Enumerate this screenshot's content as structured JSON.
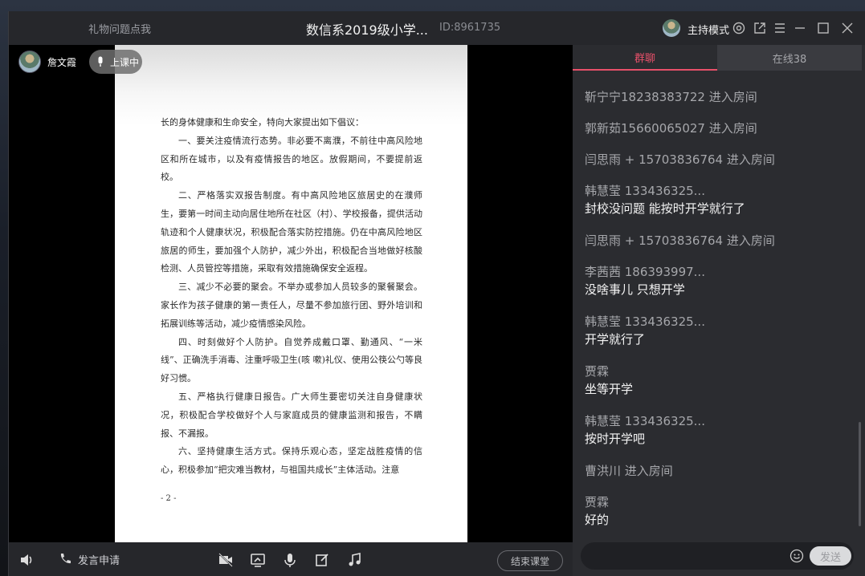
{
  "title_bar": {
    "gift_link": "礼物问题点我",
    "room_title": "数信系2019级小学...",
    "room_id": "ID:8961735",
    "host_mode": "主持模式",
    "icons": [
      "settings-icon",
      "share-icon",
      "menu-icon",
      "minimize-icon",
      "maximize-icon",
      "close-icon"
    ]
  },
  "stage": {
    "teacher_name": "詹文霞",
    "class_status": "上课中",
    "document": {
      "paragraphs": [
        "长的身体健康和生命安全，特向大家提出如下倡议：",
        "一、要关注疫情流行态势。非必要不离濮，不前往中高风险地区和所在城市，以及有疫情报告的地区。放假期间，不要提前返校。",
        "二、严格落实双报告制度。有中高风险地区旅居史的在濮师生，要第一时间主动向居住地所在社区（村）、学校报备，提供活动轨迹和个人健康状况，积极配合落实防控措施。仍在中高风险地区旅居的师生，要加强个人防护，减少外出，积极配合当地做好核酸检测、人员管控等措施，采取有效措施确保安全返程。",
        "三、减少不必要的聚会。不举办或参加人员较多的聚餐聚会。家长作为孩子健康的第一责任人，尽量不参加旅行团、野外培训和拓展训练等活动，减少疫情感染风险。",
        "四、时刻做好个人防护。自觉养成戴口罩、勤通风、“一米线”、正确洗手消毒、注重呼吸卫生(咳 嗽)礼仪、使用公筷公勺等良好习惯。",
        "五、严格执行健康日报告。广大师生要密切关注自身健康状况，积极配合学校做好个人与家庭成员的健康监测和报告，不瞒报、不漏报。",
        "六、坚持健康生活方式。保持乐观心态，坚定战胜疫情的信心，积极参加“把灾难当教材，与祖国共成长”主体活动。注意"
      ],
      "page_number": "- 2 -"
    }
  },
  "bottom_bar": {
    "speak_request": "发言申请",
    "end_class": "结束课堂",
    "icons": [
      "speaker-icon",
      "phone-icon",
      "camera-off-icon",
      "screen-share-icon",
      "microphone-icon",
      "edit-icon",
      "music-icon"
    ]
  },
  "chat": {
    "tabs": [
      {
        "label": "群聊",
        "active": true
      },
      {
        "label": "在线38",
        "active": false
      }
    ],
    "messages": [
      {
        "sender": "靳宁宁18238383722 进入房间",
        "content": ""
      },
      {
        "sender": "郭新茹15660065027 进入房间",
        "content": ""
      },
      {
        "sender": "闫思雨 + 15703836764 进入房间",
        "content": ""
      },
      {
        "sender": "韩慧莹   133436325...",
        "content": "封校没问题  能按时开学就行了"
      },
      {
        "sender": "闫思雨 + 15703836764 进入房间",
        "content": ""
      },
      {
        "sender": "李茜茜   186393997...",
        "content": "没啥事儿  只想开学"
      },
      {
        "sender": "韩慧莹   133436325...",
        "content": "开学就行了"
      },
      {
        "sender": "贾霖",
        "content": "坐等开学"
      },
      {
        "sender": "韩慧莹   133436325...",
        "content": "按时开学吧"
      },
      {
        "sender": "曹洪川 进入房间",
        "content": ""
      },
      {
        "sender": "贾霖",
        "content": "好的"
      }
    ],
    "input_placeholder": "",
    "send_label": "发送",
    "colors": {
      "accent": "#e8506a",
      "panel": "#2b2c30"
    }
  }
}
